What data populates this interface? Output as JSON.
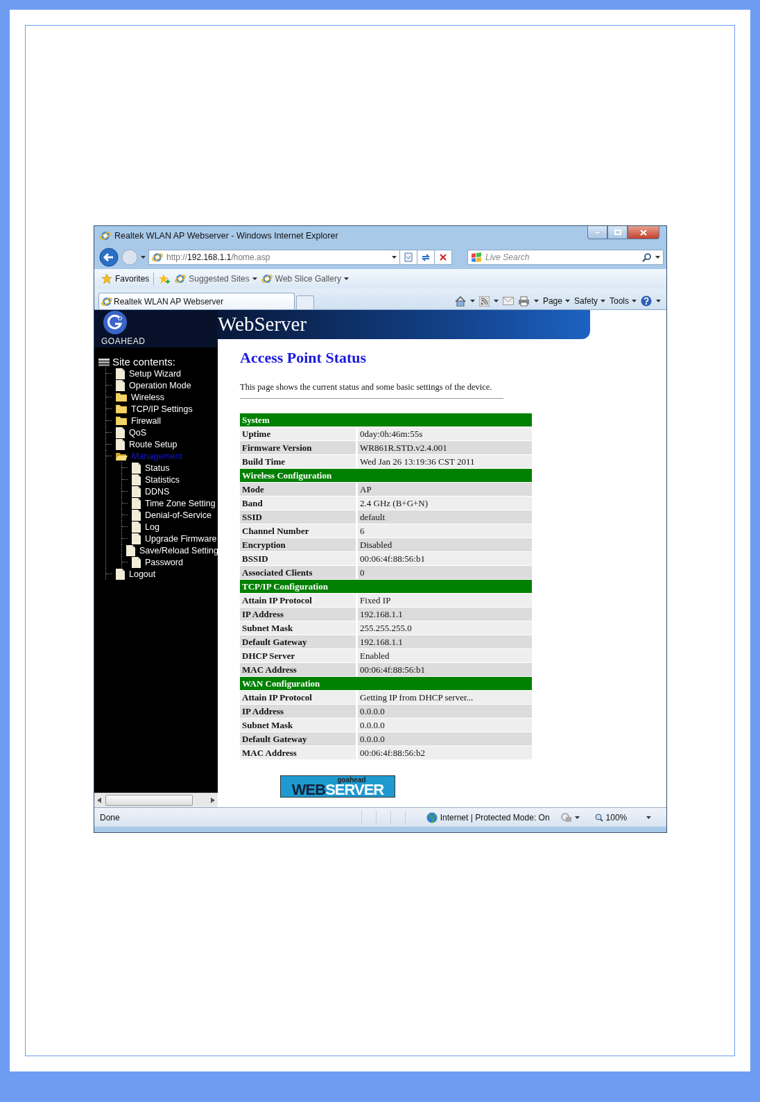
{
  "window": {
    "title": "Realtek WLAN AP Webserver - Windows Internet Explorer"
  },
  "address_bar": {
    "scheme": "http://",
    "host": "192.168.1.1",
    "path": "/home.asp"
  },
  "search": {
    "placeholder": "Live Search"
  },
  "favorites_bar": {
    "favorites": "Favorites",
    "links": [
      "Suggested Sites",
      "Web Slice Gallery"
    ]
  },
  "tabs": [
    {
      "label": "Realtek WLAN AP Webserver",
      "selected": true
    }
  ],
  "command_bar": [
    "Page",
    "Safety",
    "Tools"
  ],
  "sidebar": {
    "logo": "GOAHEAD",
    "root": "Site contents:",
    "items": [
      {
        "label": "Setup Wizard",
        "kind": "page",
        "selected": false
      },
      {
        "label": "Operation Mode",
        "kind": "page",
        "selected": false
      },
      {
        "label": "Wireless",
        "kind": "folder",
        "selected": false,
        "expanded": false
      },
      {
        "label": "TCP/IP Settings",
        "kind": "folder",
        "selected": false,
        "expanded": false
      },
      {
        "label": "Firewall",
        "kind": "folder",
        "selected": false,
        "expanded": false
      },
      {
        "label": "QoS",
        "kind": "page",
        "selected": false
      },
      {
        "label": "Route Setup",
        "kind": "page",
        "selected": false
      },
      {
        "label": "Management",
        "kind": "folder",
        "selected": true,
        "expanded": true,
        "children": [
          {
            "label": "Status",
            "kind": "page",
            "selected": false
          },
          {
            "label": "Statistics",
            "kind": "page",
            "selected": false
          },
          {
            "label": "DDNS",
            "kind": "page",
            "selected": false
          },
          {
            "label": "Time Zone Setting",
            "kind": "page",
            "selected": false
          },
          {
            "label": "Denial-of-Service",
            "kind": "page",
            "selected": false
          },
          {
            "label": "Log",
            "kind": "page",
            "selected": false
          },
          {
            "label": "Upgrade Firmware",
            "kind": "page",
            "selected": false
          },
          {
            "label": "Save/Reload Setting",
            "kind": "page",
            "selected": false
          },
          {
            "label": "Password",
            "kind": "page",
            "selected": false
          }
        ]
      },
      {
        "label": "Logout",
        "kind": "page",
        "selected": false
      }
    ]
  },
  "banner": "WebServer",
  "page": {
    "title": "Access Point Status",
    "description": "This page shows the current status and some basic settings of the device.",
    "sections": [
      {
        "title": "System",
        "rows": [
          {
            "label": "Uptime",
            "value": "0day:0h:46m:55s"
          },
          {
            "label": "Firmware Version",
            "value": "WR861R.STD.v2.4.001"
          },
          {
            "label": "Build Time",
            "value": "Wed Jan 26 13:19:36 CST 2011"
          }
        ]
      },
      {
        "title": "Wireless Configuration",
        "rows": [
          {
            "label": "Mode",
            "value": "AP"
          },
          {
            "label": "Band",
            "value": "2.4 GHz (B+G+N)"
          },
          {
            "label": "SSID",
            "value": "default"
          },
          {
            "label": "Channel Number",
            "value": "6"
          },
          {
            "label": "Encryption",
            "value": "Disabled"
          },
          {
            "label": "BSSID",
            "value": "00:06:4f:88:56:b1"
          },
          {
            "label": "Associated Clients",
            "value": "0"
          }
        ]
      },
      {
        "title": "TCP/IP Configuration",
        "rows": [
          {
            "label": "Attain IP Protocol",
            "value": "Fixed IP"
          },
          {
            "label": "IP Address",
            "value": "192.168.1.1"
          },
          {
            "label": "Subnet Mask",
            "value": "255.255.255.0"
          },
          {
            "label": "Default Gateway",
            "value": "192.168.1.1"
          },
          {
            "label": "DHCP Server",
            "value": "Enabled"
          },
          {
            "label": "MAC Address",
            "value": "00:06:4f:88:56:b1"
          }
        ]
      },
      {
        "title": "WAN Configuration",
        "rows": [
          {
            "label": "Attain IP Protocol",
            "value": "Getting IP from DHCP server..."
          },
          {
            "label": "IP Address",
            "value": "0.0.0.0"
          },
          {
            "label": "Subnet Mask",
            "value": "0.0.0.0"
          },
          {
            "label": "Default Gateway",
            "value": "0.0.0.0"
          },
          {
            "label": "MAC Address",
            "value": "00:06:4f:88:56:b2"
          }
        ]
      }
    ],
    "footer_logo": {
      "small": "goahead",
      "left": "WEB",
      "right": "SERVER"
    }
  },
  "status_bar": {
    "text": "Done",
    "zone": "Internet | Protected Mode: On",
    "zoom": "100%"
  }
}
